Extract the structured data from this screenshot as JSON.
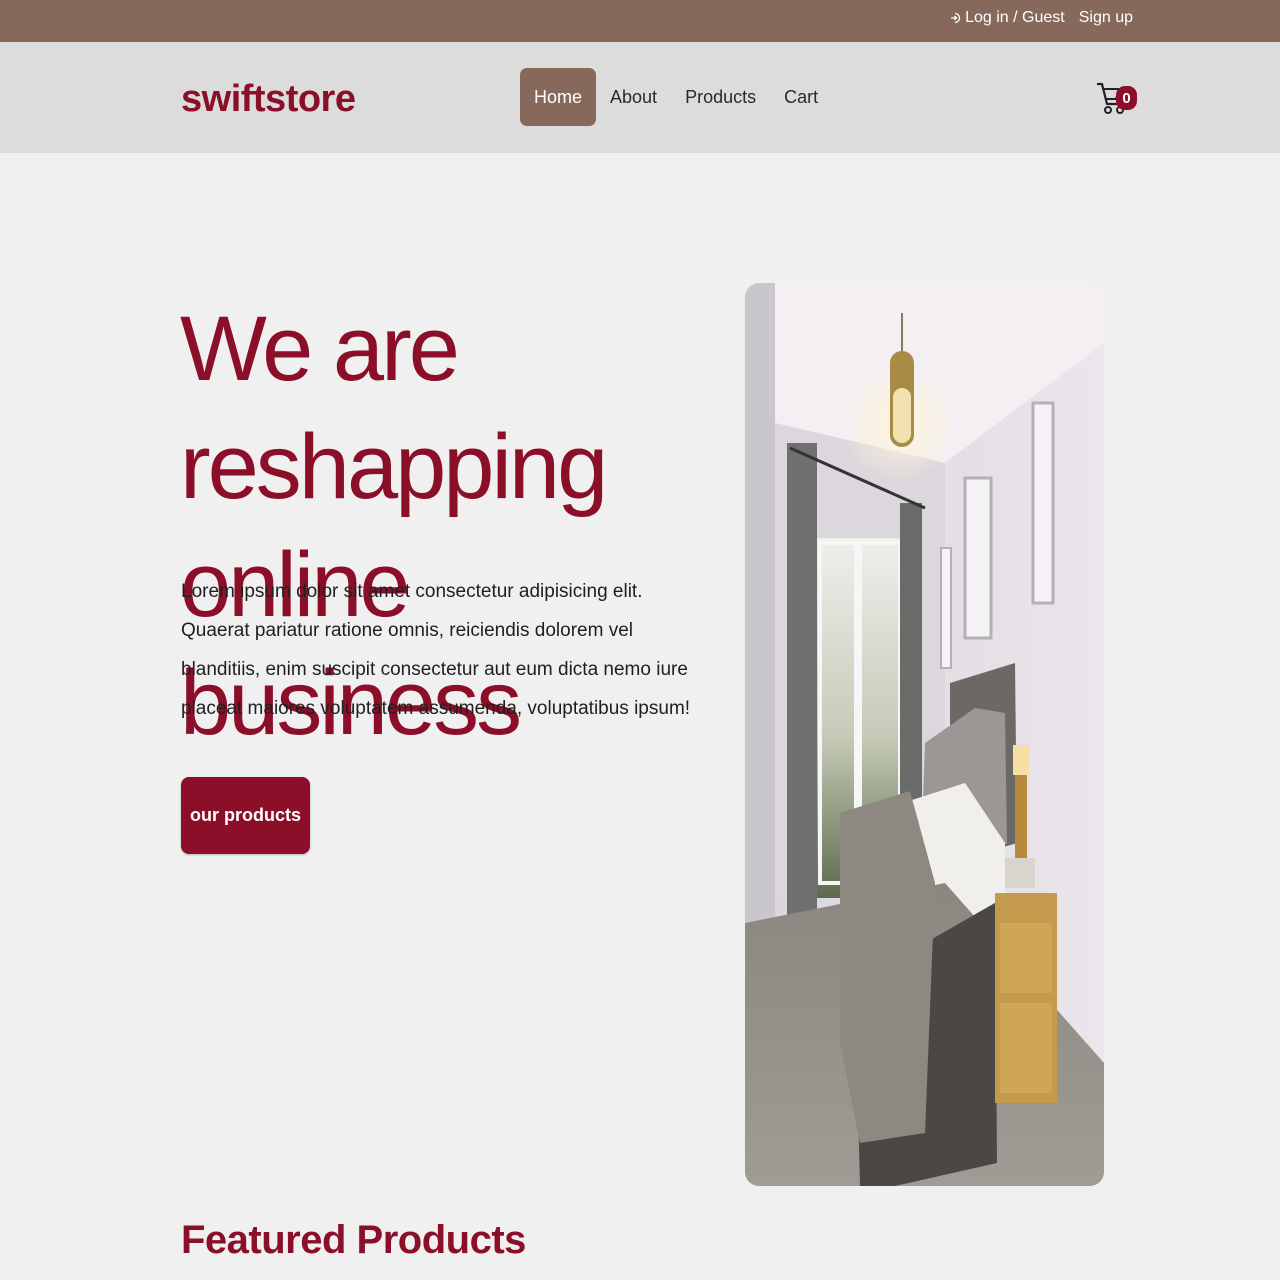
{
  "topbar": {
    "login_label": "Log in / Guest",
    "signup_label": "Sign up"
  },
  "navbar": {
    "brand": "swiftstore",
    "links": [
      {
        "label": "Home",
        "active": true
      },
      {
        "label": "About",
        "active": false
      },
      {
        "label": "Products",
        "active": false
      },
      {
        "label": "Cart",
        "active": false
      }
    ],
    "cart_count": "0",
    "theme_icon": "moon-icon",
    "cart_icon": "cart-icon"
  },
  "hero": {
    "title": "We are reshapping online business",
    "description": "Lorem ipsum dolor sit amet consectetur adipisicing elit. Quaerat pariatur ratione omnis, reiciendis dolorem vel blanditiis, enim suscipit consectetur aut eum dicta nemo iure placeat maiores voluptatem assumenda, voluptatibus ipsum!",
    "cta_label": "our products"
  },
  "featured": {
    "heading": "Featured Products"
  },
  "colors": {
    "primary": "#8c0f2a",
    "topbar": "#86695a",
    "navbar": "#dcdcdc",
    "background": "#f1f0f0"
  }
}
